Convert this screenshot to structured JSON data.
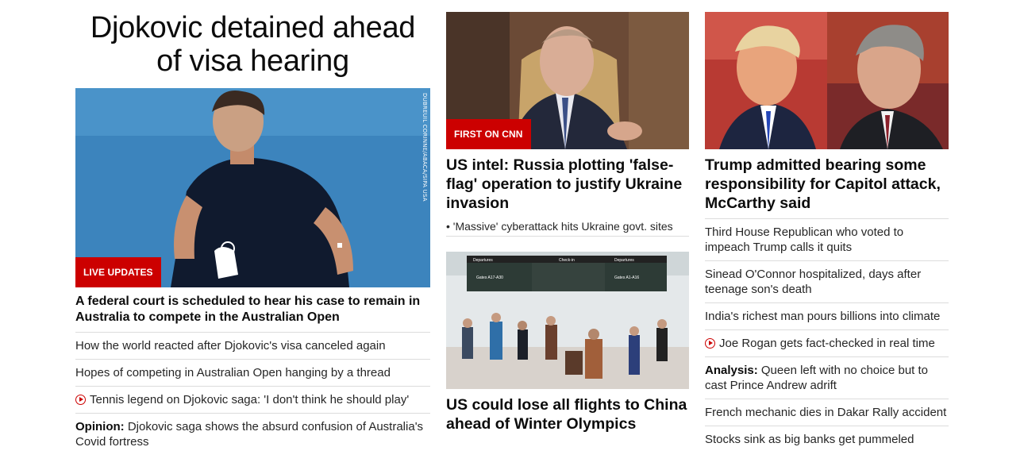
{
  "lead": {
    "headline": "Djokovic detained ahead of visa hearing",
    "badge": "LIVE UPDATES",
    "photo_credit": "DUBREUIL CORINNE/ABACA/SIPA USA",
    "subhead": "A federal court is scheduled to hear his case to remain in Australia to compete in the Australian Open",
    "items": [
      {
        "text": "How the world reacted after Djokovic's visa canceled again"
      },
      {
        "text": "Hopes of competing in Australian Open hanging by a thread"
      },
      {
        "text": "Tennis legend on Djokovic saga: 'I don't think he should play'",
        "icon": "play-icon"
      },
      {
        "kicker": "Opinion:",
        "text": " Djokovic saga shows the absurd confusion of Australia's Covid fortress"
      }
    ]
  },
  "middle": {
    "story1": {
      "badge": "FIRST ON CNN",
      "headline": "US intel: Russia plotting 'false-flag' operation to justify Ukraine invasion",
      "bullet": "• 'Massive' cyberattack hits Ukraine govt. sites"
    },
    "story2": {
      "headline": "US could lose all flights to China ahead of Winter Olympics",
      "signs": [
        "Departures",
        "Check-in",
        "Departures",
        "Gates A17-A30",
        "Gates A1-A16"
      ]
    }
  },
  "right": {
    "headline": "Trump admitted bearing some responsibility for Capitol attack, McCarthy said",
    "items": [
      {
        "text": "Third House Republican who voted to impeach Trump calls it quits"
      },
      {
        "text": "Sinead O'Connor hospitalized, days after teenage son's death"
      },
      {
        "text": "India's richest man pours billions into climate"
      },
      {
        "text": "Joe Rogan gets fact-checked in real time",
        "icon": "play-icon"
      },
      {
        "kicker": "Analysis:",
        "text": " Queen left with no choice but to cast Prince Andrew adrift"
      },
      {
        "text": "French mechanic dies in Dakar Rally accident"
      },
      {
        "text": "Stocks sink as big banks get pummeled"
      }
    ]
  },
  "colors": {
    "accent": "#cc0000",
    "divider": "#dcdcdc",
    "text": "#0c0c0c"
  }
}
